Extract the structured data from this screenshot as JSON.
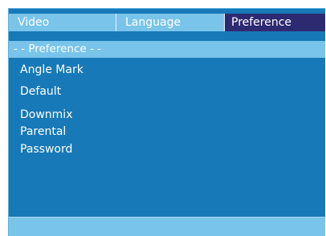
{
  "tabs": [
    {
      "label": "Video"
    },
    {
      "label": "Language"
    },
    {
      "label": "Preference"
    }
  ],
  "active_tab": "Preference",
  "section": {
    "title": "- - Preference - -"
  },
  "menu": {
    "items": [
      {
        "label": "Angle Mark"
      },
      {
        "label": "Default"
      },
      {
        "label": "Downmix"
      },
      {
        "label": "Parental"
      },
      {
        "label": "Password"
      }
    ]
  },
  "status_bar": {
    "text": ""
  },
  "colors": {
    "panel": "#1779b8",
    "bar": "#79c4ea",
    "active_tab": "#2e2a72",
    "text": "#ffffff"
  }
}
